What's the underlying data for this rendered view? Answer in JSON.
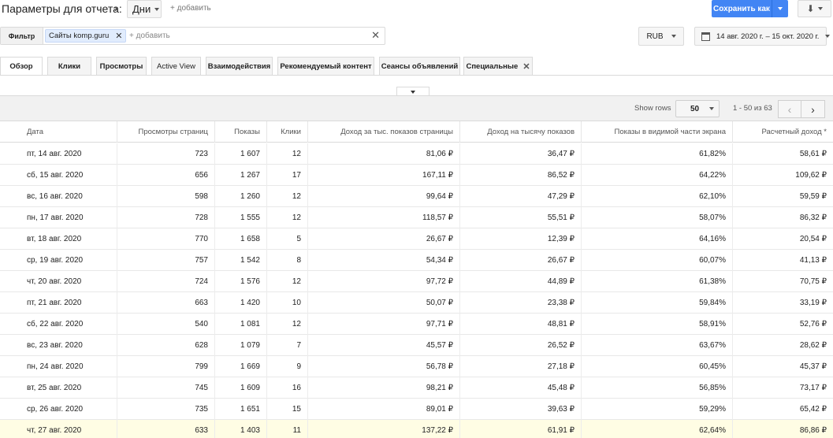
{
  "header": {
    "params_title": "Параметры для отчета:",
    "params_chevron": "›",
    "days_label": "Дни",
    "add_label": "+ добавить",
    "save_label": "Сохранить как",
    "download_icon": "⬇"
  },
  "filter": {
    "label": "Фильтр",
    "chip_label": "Сайты komp.guru",
    "chip_remove": "✕",
    "add_label": "+ добавить",
    "clear": "✕"
  },
  "currency": "RUB",
  "date_range": "14 авг. 2020 г. – 15 окт. 2020 г.",
  "tabs": [
    {
      "label": "Обзор"
    },
    {
      "label": "Клики"
    },
    {
      "label": "Просмотры"
    },
    {
      "label": "Active View"
    },
    {
      "label": "Взаимодействия"
    },
    {
      "label": "Рекомендуемый контент"
    },
    {
      "label": "Сеансы объявлений"
    },
    {
      "label": "Специальные",
      "close": "✕"
    }
  ],
  "grid": {
    "show_rows_label": "Show rows",
    "rows_value": "50",
    "range_text": "1 - 50 из 63",
    "prev": "‹",
    "next": "›"
  },
  "table": {
    "columns": [
      "Дата",
      "Просмотры страниц",
      "Показы",
      "Клики",
      "Доход за тыс. показов страницы",
      "Доход на тысячу показов",
      "Показы в видимой части экрана",
      "Расчетный доход *"
    ],
    "rows": [
      [
        "пт, 14 авг. 2020",
        "723",
        "1 607",
        "12",
        "81,06 ₽",
        "36,47 ₽",
        "61,82%",
        "58,61 ₽"
      ],
      [
        "сб, 15 авг. 2020",
        "656",
        "1 267",
        "17",
        "167,11 ₽",
        "86,52 ₽",
        "64,22%",
        "109,62 ₽"
      ],
      [
        "вс, 16 авг. 2020",
        "598",
        "1 260",
        "12",
        "99,64 ₽",
        "47,29 ₽",
        "62,10%",
        "59,59 ₽"
      ],
      [
        "пн, 17 авг. 2020",
        "728",
        "1 555",
        "12",
        "118,57 ₽",
        "55,51 ₽",
        "58,07%",
        "86,32 ₽"
      ],
      [
        "вт, 18 авг. 2020",
        "770",
        "1 658",
        "5",
        "26,67 ₽",
        "12,39 ₽",
        "64,16%",
        "20,54 ₽"
      ],
      [
        "ср, 19 авг. 2020",
        "757",
        "1 542",
        "8",
        "54,34 ₽",
        "26,67 ₽",
        "60,07%",
        "41,13 ₽"
      ],
      [
        "чт, 20 авг. 2020",
        "724",
        "1 576",
        "12",
        "97,72 ₽",
        "44,89 ₽",
        "61,38%",
        "70,75 ₽"
      ],
      [
        "пт, 21 авг. 2020",
        "663",
        "1 420",
        "10",
        "50,07 ₽",
        "23,38 ₽",
        "59,84%",
        "33,19 ₽"
      ],
      [
        "сб, 22 авг. 2020",
        "540",
        "1 081",
        "12",
        "97,71 ₽",
        "48,81 ₽",
        "58,91%",
        "52,76 ₽"
      ],
      [
        "вс, 23 авг. 2020",
        "628",
        "1 079",
        "7",
        "45,57 ₽",
        "26,52 ₽",
        "63,67%",
        "28,62 ₽"
      ],
      [
        "пн, 24 авг. 2020",
        "799",
        "1 669",
        "9",
        "56,78 ₽",
        "27,18 ₽",
        "60,45%",
        "45,37 ₽"
      ],
      [
        "вт, 25 авг. 2020",
        "745",
        "1 609",
        "16",
        "98,21 ₽",
        "45,48 ₽",
        "56,85%",
        "73,17 ₽"
      ],
      [
        "ср, 26 авг. 2020",
        "735",
        "1 651",
        "15",
        "89,01 ₽",
        "39,63 ₽",
        "59,29%",
        "65,42 ₽"
      ],
      [
        "чт, 27 авг. 2020",
        "633",
        "1 403",
        "11",
        "137,22 ₽",
        "61,91 ₽",
        "62,64%",
        "86,86 ₽"
      ]
    ]
  }
}
